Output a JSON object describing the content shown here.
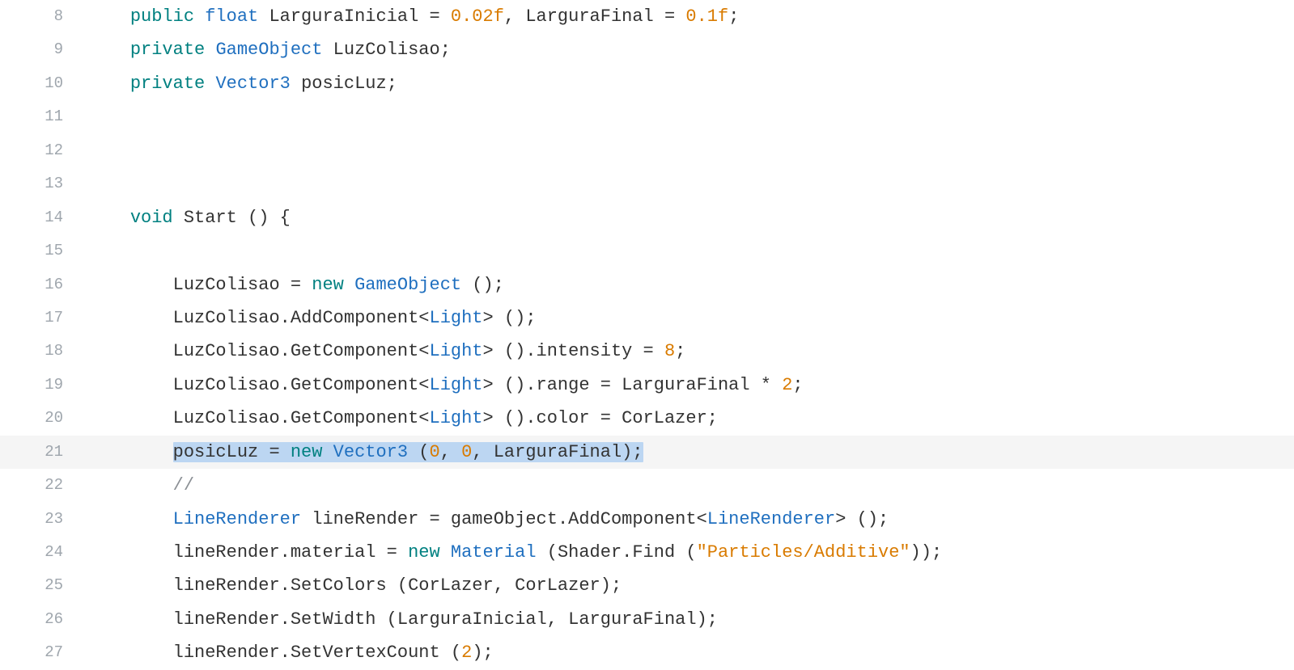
{
  "lines": {
    "l8": {
      "num": "8"
    },
    "l9": {
      "num": "9"
    },
    "l10": {
      "num": "10"
    },
    "l11": {
      "num": "11"
    },
    "l12": {
      "num": "12"
    },
    "l13": {
      "num": "13"
    },
    "l14": {
      "num": "14"
    },
    "l15": {
      "num": "15"
    },
    "l16": {
      "num": "16"
    },
    "l17": {
      "num": "17"
    },
    "l18": {
      "num": "18"
    },
    "l19": {
      "num": "19"
    },
    "l20": {
      "num": "20"
    },
    "l21": {
      "num": "21"
    },
    "l22": {
      "num": "22"
    },
    "l23": {
      "num": "23"
    },
    "l24": {
      "num": "24"
    },
    "l25": {
      "num": "25"
    },
    "l26": {
      "num": "26"
    },
    "l27": {
      "num": "27"
    }
  },
  "tok": {
    "kw_public": "public",
    "kw_private": "private",
    "kw_void": "void",
    "kw_new": "new",
    "ty_float": "float",
    "ty_GameObject": "GameObject",
    "ty_Vector3": "Vector3",
    "ty_Light": "Light",
    "ty_LineRenderer": "LineRenderer",
    "ty_Material": "Material",
    "id_LarguraInicial": "LarguraInicial",
    "id_LarguraFinal": "LarguraFinal",
    "id_LuzColisao": "LuzColisao",
    "id_posicLuz": "posicLuz",
    "id_Start": "Start",
    "id_AddComponent": "AddComponent",
    "id_GetComponent": "GetComponent",
    "id_intensity": "intensity",
    "id_range": "range",
    "id_color": "color",
    "id_CorLazer": "CorLazer",
    "id_lineRender": "lineRender",
    "id_gameObject": "gameObject",
    "id_material": "material",
    "id_Shader": "Shader",
    "id_Find": "Find",
    "id_SetColors": "SetColors",
    "id_SetWidth": "SetWidth",
    "id_SetVertexCount": "SetVertexCount",
    "num_002f": "0.02f",
    "num_01f": "0.1f",
    "num_8": "8",
    "num_2": "2",
    "num_0a": "0",
    "num_0b": "0",
    "num_2b": "2",
    "str_particles": "\"Particles/Additive\"",
    "cmt_slashes": "//",
    "p_sp": " ",
    "p_eq": " = ",
    "p_eq2": " = ",
    "p_comma": ", ",
    "p_semi": ";",
    "p_lpar": " (",
    "p_lpar_t": "(",
    "p_rpar": ")",
    "p_lbrace": " {",
    "p_lt": "<",
    "p_gt": ">",
    "p_dot": ".",
    "p_mul": " * ",
    "p_rpar_semi": ");",
    "p_rpar_rpar_semi": "));",
    "ind1": "    ",
    "ind2": "        "
  }
}
